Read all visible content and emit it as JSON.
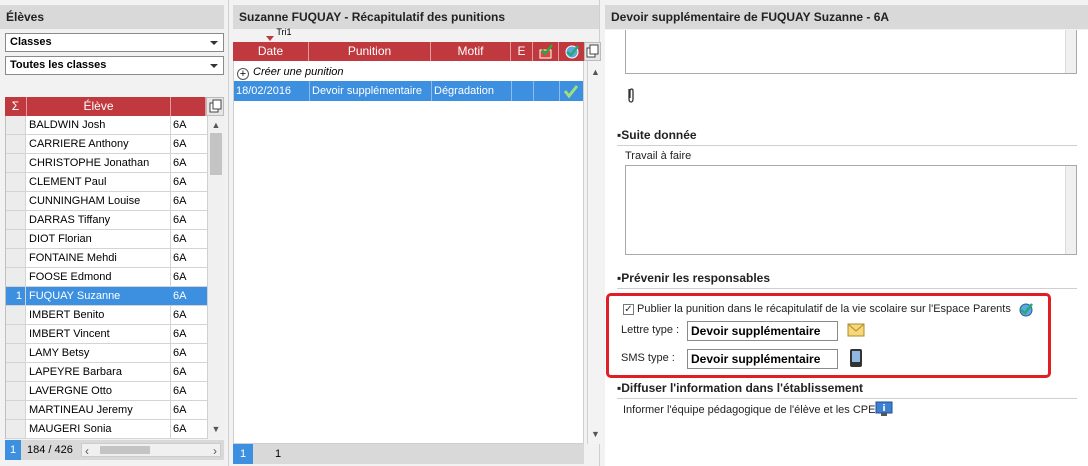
{
  "left": {
    "title": "Élèves",
    "select_classes": "Classes",
    "select_all": "Toutes les classes",
    "col_sigma": "Σ",
    "col_student": "Élève",
    "students": [
      {
        "idx": "",
        "name": "BALDWIN Josh",
        "class": "6A",
        "selected": false
      },
      {
        "idx": "",
        "name": "CARRIERE Anthony",
        "class": "6A",
        "selected": false
      },
      {
        "idx": "",
        "name": "CHRISTOPHE Jonathan",
        "class": "6A",
        "selected": false
      },
      {
        "idx": "",
        "name": "CLEMENT Paul",
        "class": "6A",
        "selected": false
      },
      {
        "idx": "",
        "name": "CUNNINGHAM Louise",
        "class": "6A",
        "selected": false
      },
      {
        "idx": "",
        "name": "DARRAS Tiffany",
        "class": "6A",
        "selected": false
      },
      {
        "idx": "",
        "name": "DIOT Florian",
        "class": "6A",
        "selected": false
      },
      {
        "idx": "",
        "name": "FONTAINE Mehdi",
        "class": "6A",
        "selected": false
      },
      {
        "idx": "",
        "name": "FOOSE Edmond",
        "class": "6A",
        "selected": false
      },
      {
        "idx": "1",
        "name": "FUQUAY Suzanne",
        "class": "6A",
        "selected": true
      },
      {
        "idx": "",
        "name": "IMBERT Benito",
        "class": "6A",
        "selected": false
      },
      {
        "idx": "",
        "name": "IMBERT Vincent",
        "class": "6A",
        "selected": false
      },
      {
        "idx": "",
        "name": "LAMY Betsy",
        "class": "6A",
        "selected": false
      },
      {
        "idx": "",
        "name": "LAPEYRE Barbara",
        "class": "6A",
        "selected": false
      },
      {
        "idx": "",
        "name": "LAVERGNE Otto",
        "class": "6A",
        "selected": false
      },
      {
        "idx": "",
        "name": "MARTINEAU Jeremy",
        "class": "6A",
        "selected": false
      },
      {
        "idx": "",
        "name": "MAUGERI Sonia",
        "class": "6A",
        "selected": false
      }
    ],
    "footer_count": "1",
    "footer_range": "184 / 426"
  },
  "middle": {
    "title": "Suzanne FUQUAY - Récapitulatif des punitions",
    "sort_label": "Tri1",
    "col_date": "Date",
    "col_punition": "Punition",
    "col_motif": "Motif",
    "col_e": "E",
    "create_label": "Créer une punition",
    "rows": [
      {
        "date": "18/02/2016",
        "punition": "Devoir supplémentaire",
        "motif": "Dégradation",
        "e": ""
      }
    ],
    "footer_count": "1",
    "footer_page": "1"
  },
  "right": {
    "title": "Devoir supplémentaire  de FUQUAY Suzanne  - 6A",
    "suite_heading": "Suite donnée",
    "travail_label": "Travail à faire",
    "prevenir_heading": "Prévenir les responsables",
    "publish_label": "Publier la punition dans le récapitulatif de la vie scolaire sur l'Espace Parents",
    "publish_checked": true,
    "lettre_label": "Lettre type :",
    "lettre_value": "Devoir supplémentaire",
    "sms_label": "SMS type :",
    "sms_value": "Devoir supplémentaire",
    "diffuser_heading": "Diffuser l'information dans l'établissement",
    "informer_label": "Informer l'équipe pédagogique de l'élève et les CPE"
  },
  "colors": {
    "header_red": "#c0393f",
    "selection_blue": "#3d8fe0",
    "highlight_frame": "#e01f25"
  }
}
